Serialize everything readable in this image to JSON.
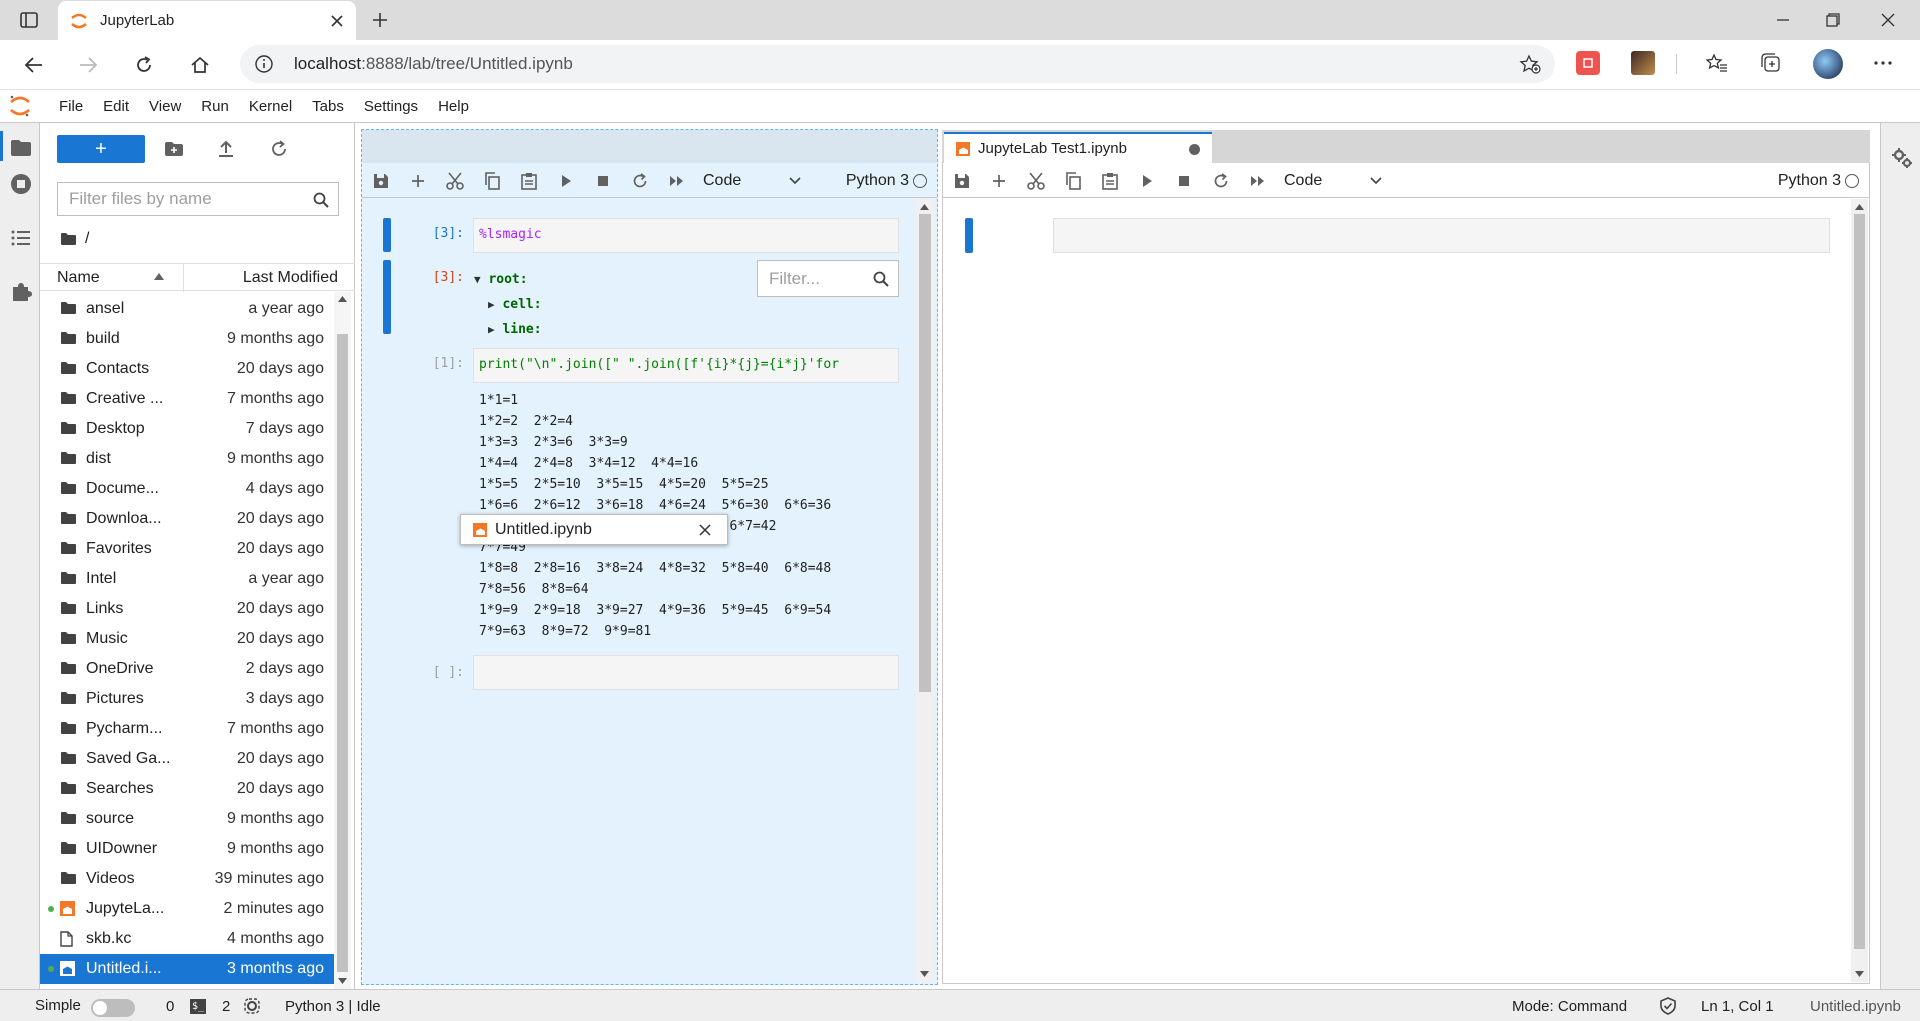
{
  "browser": {
    "tab_title": "JupyterLab",
    "url_host": "localhost",
    "url_rest": ":8888/lab/tree/Untitled.ipynb"
  },
  "menu": [
    "File",
    "Edit",
    "View",
    "Run",
    "Kernel",
    "Tabs",
    "Settings",
    "Help"
  ],
  "filebrowser": {
    "new_label": "+",
    "filter_placeholder": "Filter files by name",
    "breadcrumb": "/",
    "col_name": "Name",
    "col_modified": "Last Modified",
    "files": [
      {
        "name": "ansel",
        "modified": "a year ago",
        "type": "folder"
      },
      {
        "name": "build",
        "modified": "9 months ago",
        "type": "folder"
      },
      {
        "name": "Contacts",
        "modified": "20 days ago",
        "type": "folder"
      },
      {
        "name": "Creative ...",
        "modified": "7 months ago",
        "type": "folder"
      },
      {
        "name": "Desktop",
        "modified": "7 days ago",
        "type": "folder"
      },
      {
        "name": "dist",
        "modified": "9 months ago",
        "type": "folder"
      },
      {
        "name": "Docume...",
        "modified": "4 days ago",
        "type": "folder"
      },
      {
        "name": "Downloa...",
        "modified": "20 days ago",
        "type": "folder"
      },
      {
        "name": "Favorites",
        "modified": "20 days ago",
        "type": "folder"
      },
      {
        "name": "Intel",
        "modified": "a year ago",
        "type": "folder"
      },
      {
        "name": "Links",
        "modified": "20 days ago",
        "type": "folder"
      },
      {
        "name": "Music",
        "modified": "20 days ago",
        "type": "folder"
      },
      {
        "name": "OneDrive",
        "modified": "2 days ago",
        "type": "folder"
      },
      {
        "name": "Pictures",
        "modified": "3 days ago",
        "type": "folder"
      },
      {
        "name": "Pycharm...",
        "modified": "7 months ago",
        "type": "folder"
      },
      {
        "name": "Saved Ga...",
        "modified": "20 days ago",
        "type": "folder"
      },
      {
        "name": "Searches",
        "modified": "20 days ago",
        "type": "folder"
      },
      {
        "name": "source",
        "modified": "9 months ago",
        "type": "folder"
      },
      {
        "name": "UIDowner",
        "modified": "9 months ago",
        "type": "folder"
      },
      {
        "name": "Videos",
        "modified": "39 minutes ago",
        "type": "folder"
      },
      {
        "name": "JupyteLa...",
        "modified": "2 minutes ago",
        "type": "notebook",
        "running": true
      },
      {
        "name": "skb.kc",
        "modified": "4 months ago",
        "type": "file"
      },
      {
        "name": "Untitled.i...",
        "modified": "3 months ago",
        "type": "notebook",
        "running": true,
        "selected": true
      }
    ]
  },
  "left_notebook": {
    "tab_title": "Untitled.ipynb",
    "cell_type": "Code",
    "kernel": "Python 3",
    "cell1_prompt": "[3]:",
    "cell1_source_magic": "%lsmagic",
    "cell1_out_prompt": "[3]:",
    "json_tree": [
      "root:",
      "cell:",
      "line:"
    ],
    "filter_placeholder": "Filter...",
    "cell2_prompt": "[1]:",
    "cell2_source": "print(\"\\n\".join([\"  \".join([f'{i}*{j}={i*j}'for",
    "cell2_output": [
      "1*1=1",
      "1*2=2  2*2=4",
      "1*3=3  2*3=6  3*3=9",
      "1*4=4  2*4=8  3*4=12  4*4=16",
      "1*5=5  2*5=10  3*5=15  4*5=20  5*5=25",
      "1*6=6  2*6=12  3*6=18  4*6=24  5*6=30  6*6=36",
      "                     8  5*7=35  6*7=42",
      "7*7=49",
      "1*8=8  2*8=16  3*8=24  4*8=32  5*8=40  6*8=48",
      "7*8=56  8*8=64",
      "1*9=9  2*9=18  3*9=27  4*9=36  5*9=45  6*9=54",
      "7*9=63  8*9=72  9*9=81"
    ],
    "cell3_prompt": "[ ]:"
  },
  "right_notebook": {
    "tab_title": "JupyteLab Test1.ipynb",
    "cell_type": "Code",
    "kernel": "Python 3",
    "cell_prompt": "[ ]:"
  },
  "statusbar": {
    "mode_label": "Simple",
    "terminals": "0",
    "kernels": "2",
    "kernel_status": "Python 3 | Idle",
    "mode": "Mode: Command",
    "position": "Ln 1, Col 1",
    "file": "Untitled.ipynb"
  },
  "colors": {
    "accent": "#1976d2",
    "jupyter_orange": "#f37726",
    "selected_panel": "#e3f2fd"
  }
}
